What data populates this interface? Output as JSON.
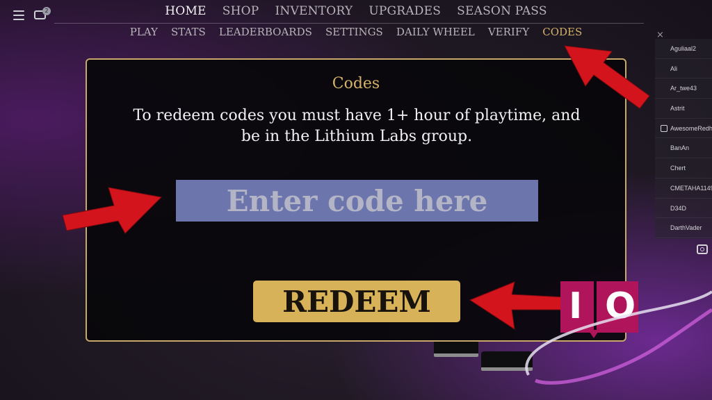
{
  "topbar": {
    "chat_badge": "2",
    "main_nav": [
      "HOME",
      "SHOP",
      "INVENTORY",
      "UPGRADES",
      "SEASON PASS"
    ],
    "main_active": "HOME",
    "sub_nav": [
      "PLAY",
      "STATS",
      "LEADERBOARDS",
      "SETTINGS",
      "DAILY WHEEL",
      "VERIFY",
      "CODES"
    ],
    "sub_active": "CODES"
  },
  "codes_panel": {
    "title": "Codes",
    "description_line1": "To redeem codes you must have 1+ hour of playtime, and",
    "description_line2": "be in the Lithium Labs group.",
    "input_placeholder": "Enter code here",
    "input_value": "",
    "redeem_label": "REDEEM"
  },
  "player_list": {
    "close_label": "×",
    "players": [
      "Aguliaal2",
      "Ali",
      "Ar_twe43",
      "Astrit",
      "AwesomeRedhe",
      "BanAn",
      "Chert",
      "CMETAHA1149",
      "D34D",
      "DarthVader"
    ],
    "player_with_icon": "AwesomeRedhe"
  },
  "colors": {
    "accent_gold": "#d5b26a",
    "input_blue": "#6d75ad",
    "button_gold": "#d8b258",
    "arrow_red": "#d4141c",
    "logo_pink": "#b0155c"
  },
  "logo": {
    "letters": [
      "I",
      "O"
    ]
  }
}
